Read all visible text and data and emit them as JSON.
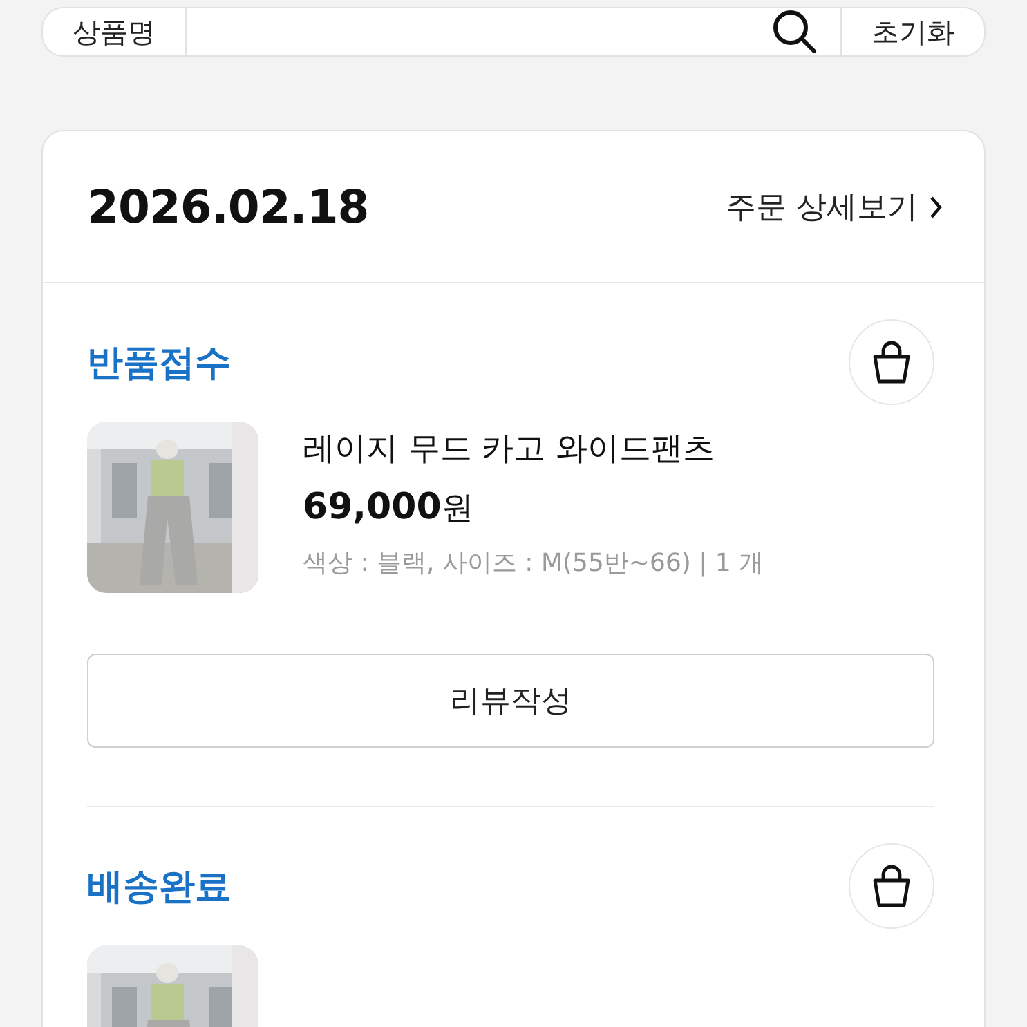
{
  "search": {
    "category": "상품명",
    "reset_label": "초기화"
  },
  "order": {
    "date": "2026.02.18",
    "detail_link": "주문 상세보기",
    "items": [
      {
        "status": "반품접수",
        "product": {
          "kind": "picture",
          "name": "레이지 무드 카고 와이드팬츠",
          "price": "69,000",
          "currency": "원",
          "options": "색상 : 블랙, 사이즈 : M(55반~66) | 1 개"
        },
        "action": "리뷰작성"
      },
      {
        "status": "배송완료"
      }
    ]
  }
}
